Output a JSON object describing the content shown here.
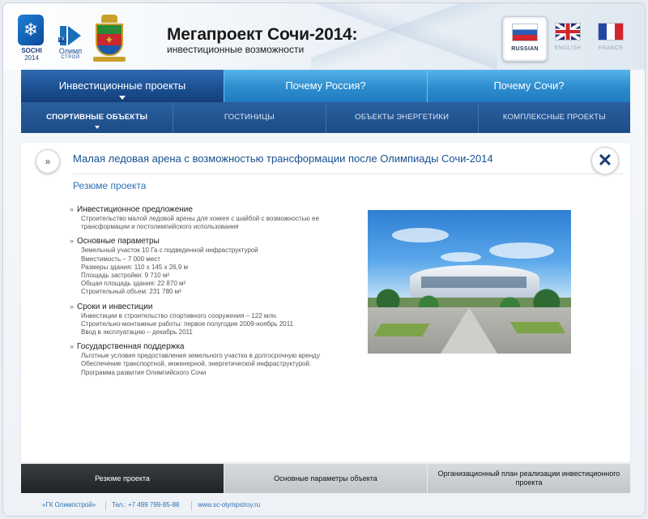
{
  "header": {
    "logos": {
      "sochi": "SOCHI",
      "sochi_year": "2014",
      "olimp_name": "Олимп",
      "olimp_sub": "СТРОЙ",
      "olimp_gk": "ГК"
    },
    "title": "Мегапроект Сочи-2014:",
    "subtitle": "инвестиционные возможности",
    "languages": [
      {
        "label": "RUSSIAN",
        "active": true,
        "flag": "flag-ru-icon"
      },
      {
        "label": "ENGLISH",
        "active": false,
        "flag": "flag-uk-icon"
      },
      {
        "label": "FRANCE",
        "active": false,
        "flag": "flag-fr-icon"
      }
    ]
  },
  "nav": {
    "items": [
      {
        "label": "Инвестиционные проекты",
        "active": true
      },
      {
        "label": "Почему Россия?",
        "active": false
      },
      {
        "label": "Почему Сочи?",
        "active": false
      }
    ]
  },
  "subnav": {
    "items": [
      {
        "label": "СПОРТИВНЫЕ ОБЪЕКТЫ",
        "active": true
      },
      {
        "label": "ГОСТИНИЦЫ",
        "active": false
      },
      {
        "label": "ОБЪЕКТЫ ЭНЕРГЕТИКИ",
        "active": false
      },
      {
        "label": "КОМПЛЕКСНЫЕ ПРОЕКТЫ",
        "active": false
      }
    ]
  },
  "content": {
    "title": "Малая ледовая арена с возможностью трансформации после Олимпиады Сочи-2014",
    "section_title": "Резюме проекта",
    "blocks": [
      {
        "heading": "Инвестиционное предложение",
        "lines": [
          "Строительство малой ледовой арены для хоккея с шайбой с возможностью ее",
          "трансформации и постолимпийского использования"
        ]
      },
      {
        "heading": "Основные параметры",
        "lines": [
          "Земельный участок 10 Га с подведенной инфраструктурой",
          "Вместимость – 7 000 мест",
          "Размеры здания: 110 х 145 х 26,9 м",
          "Площадь застройки: 9 710 м²",
          "Общая площадь здания: 22 870 м²",
          "Строительный объем: 231 780 м³"
        ]
      },
      {
        "heading": "Сроки и инвестиции",
        "lines": [
          "Инвестиции в строительство спортивного сооружения – 122 млн.",
          "Строительно-монтажные работы:  первое полугодие 2009-ноябрь 2011",
          "Ввод в эксплуатацию – декабрь 2011"
        ]
      },
      {
        "heading": "Государственная поддержка",
        "lines": [
          "Льготные условия предоставления земельного участка в долгосрочную аренду",
          "Обеспечение  транспортной, инженерной, энергетической инфраструктурой.",
          "Программа развития Олимпийского Сочи"
        ]
      }
    ]
  },
  "tabs": [
    {
      "label": "Резюме проекта",
      "active": true
    },
    {
      "label": "Основные параметры объекта",
      "active": false
    },
    {
      "label": "Организационный план реализации инвестиционного проекта",
      "active": false
    }
  ],
  "footer": {
    "company": "«ГК Олимпстрой»",
    "phone": "Тел.: +7 499 799-85-88",
    "site": "www.sc-olympstroy.ru"
  },
  "colors": {
    "accent": "#2c6fb2",
    "nav_active": "#1a4f91",
    "nav_inactive": "#2f8fd0",
    "title_blue": "#16508f"
  }
}
